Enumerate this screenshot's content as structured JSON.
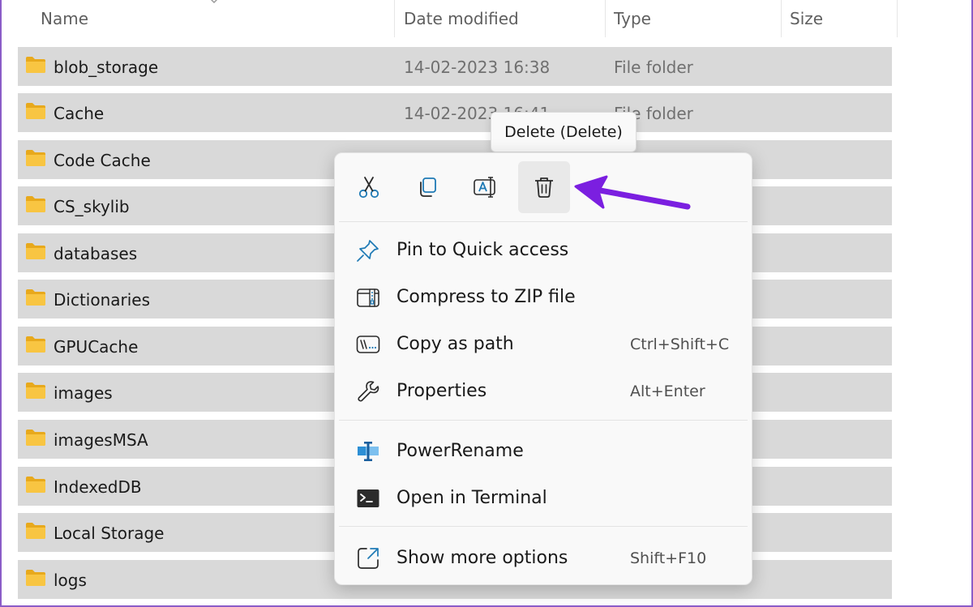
{
  "columns": {
    "name": "Name",
    "date_modified": "Date modified",
    "type": "Type",
    "size": "Size"
  },
  "rows": [
    {
      "name": "blob_storage",
      "date": "14-02-2023 16:38",
      "type": "File folder"
    },
    {
      "name": "Cache",
      "date": "14-02-2023 16:41",
      "type": "File folder"
    },
    {
      "name": "Code Cache",
      "date": "",
      "type": ""
    },
    {
      "name": "CS_skylib",
      "date": "",
      "type": ""
    },
    {
      "name": "databases",
      "date": "",
      "type": ""
    },
    {
      "name": "Dictionaries",
      "date": "",
      "type": ""
    },
    {
      "name": "GPUCache",
      "date": "",
      "type": ""
    },
    {
      "name": "images",
      "date": "",
      "type": ""
    },
    {
      "name": "imagesMSA",
      "date": "",
      "type": ""
    },
    {
      "name": "IndexedDB",
      "date": "",
      "type": ""
    },
    {
      "name": "Local Storage",
      "date": "",
      "type": ""
    },
    {
      "name": "logs",
      "date": "",
      "type": ""
    }
  ],
  "context_menu": {
    "toolbar": [
      {
        "name": "cut",
        "icon": "scissors-icon"
      },
      {
        "name": "copy",
        "icon": "copy-icon"
      },
      {
        "name": "rename",
        "icon": "rename-icon"
      },
      {
        "name": "delete",
        "icon": "trash-icon"
      }
    ],
    "items": [
      {
        "label": "Pin to Quick access",
        "shortcut": "",
        "icon": "pin-icon"
      },
      {
        "label": "Compress to ZIP file",
        "shortcut": "",
        "icon": "zip-icon"
      },
      {
        "label": "Copy as path",
        "shortcut": "Ctrl+Shift+C",
        "icon": "path-icon"
      },
      {
        "label": "Properties",
        "shortcut": "Alt+Enter",
        "icon": "wrench-icon"
      },
      {
        "label": "PowerRename",
        "shortcut": "",
        "icon": "power-rename-icon"
      },
      {
        "label": "Open in Terminal",
        "shortcut": "",
        "icon": "terminal-icon"
      },
      {
        "label": "Show more options",
        "shortcut": "Shift+F10",
        "icon": "expand-icon"
      }
    ]
  },
  "tooltip": "Delete (Delete)",
  "colors": {
    "row_selected": "#d9d9d9",
    "folder": "#f8c542",
    "accent_icon": "#1f7ab5",
    "annotation_arrow": "#7b1fe0",
    "frame_border": "#8b5cc8"
  }
}
